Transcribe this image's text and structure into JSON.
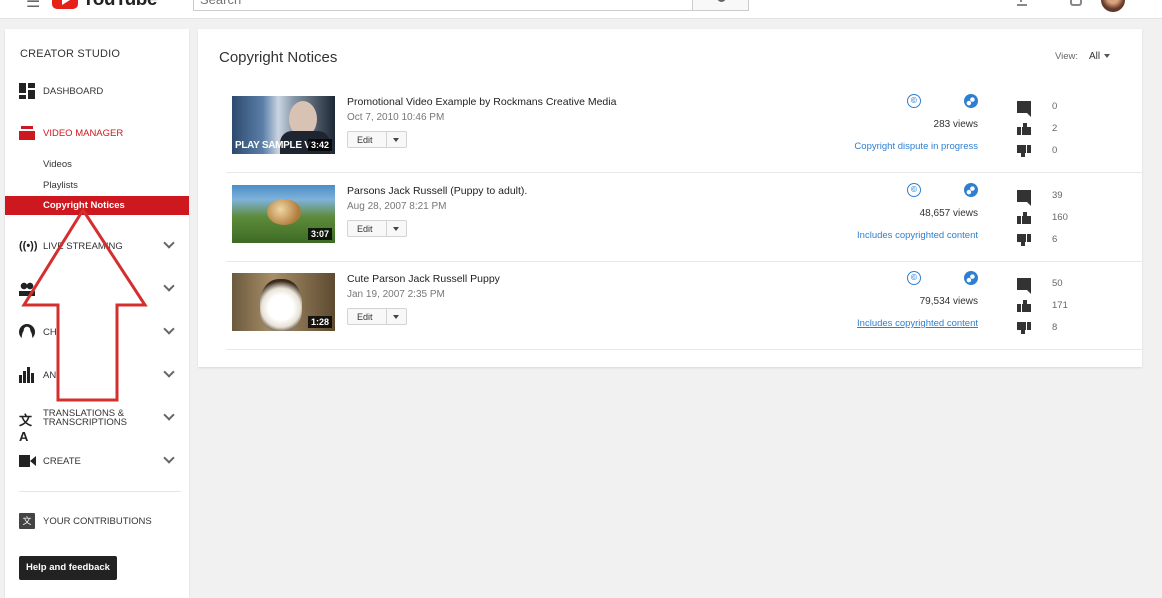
{
  "header": {
    "logo_text": "YouTube",
    "search_placeholder": "Search"
  },
  "sidebar": {
    "title": "CREATOR STUDIO",
    "dashboard": "DASHBOARD",
    "video_manager": "VIDEO MANAGER",
    "sub_items": [
      "Videos",
      "Playlists",
      "Copyright Notices"
    ],
    "live_streaming": "LIVE STREAMING",
    "community": "",
    "channel": "CH",
    "analytics": "AN",
    "translations_line1": "TRANSLATIONS &",
    "translations_line2": "TRANSCRIPTIONS",
    "create": "CREATE",
    "your_contributions": "YOUR CONTRIBUTIONS",
    "help_button": "Help and feedback"
  },
  "main": {
    "title": "Copyright Notices",
    "view_label": "View:",
    "view_value": "All",
    "edit_label": "Edit",
    "videos": [
      {
        "title": "Promotional Video Example by Rockmans Creative Media",
        "date": "Oct 7, 2010 10:46 PM",
        "duration": "3:42",
        "overlay": "PLAY SAMPLE V",
        "views": "283 views",
        "status": "Copyright dispute in progress",
        "comments": "0",
        "likes": "2",
        "dislikes": "0"
      },
      {
        "title": "Parsons Jack Russell (Puppy to adult).",
        "date": "Aug 28, 2007 8:21 PM",
        "duration": "3:07",
        "overlay": "",
        "views": "48,657 views",
        "status": "Includes copyrighted content",
        "comments": "39",
        "likes": "160",
        "dislikes": "6"
      },
      {
        "title": "Cute Parson Jack Russell Puppy",
        "date": "Jan 19, 2007 2:35 PM",
        "duration": "1:28",
        "overlay": "",
        "views": "79,534 views",
        "status": "Includes copyrighted content",
        "comments": "50",
        "likes": "171",
        "dislikes": "8"
      }
    ]
  },
  "colors": {
    "accent_red": "#cc181e",
    "link_blue": "#2e7fd1",
    "annotation_arrow": "#d32f2f"
  }
}
